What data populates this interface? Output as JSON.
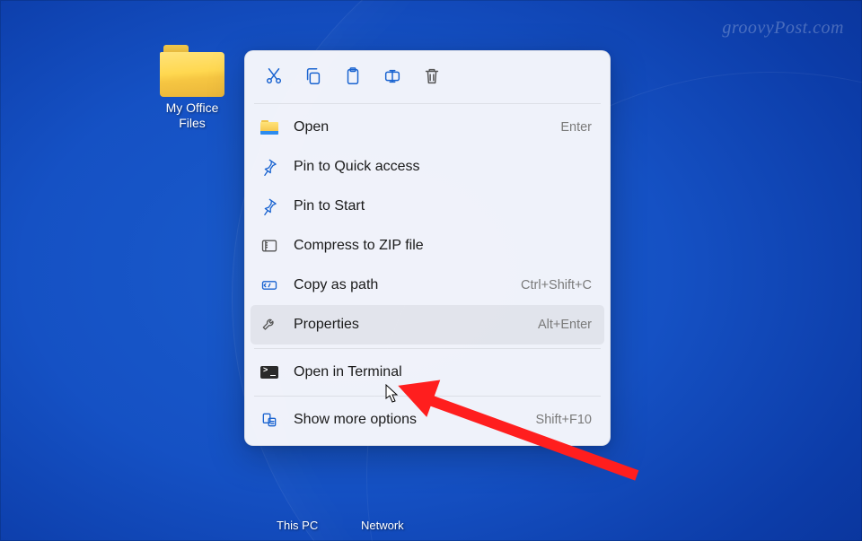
{
  "watermark": "groovyPost.com",
  "folder": {
    "label": "My Office\nFiles"
  },
  "toolbar": {
    "cut": "cut",
    "copy": "copy",
    "paste": "paste",
    "rename": "rename",
    "delete": "delete"
  },
  "menu": {
    "open": {
      "label": "Open",
      "shortcut": "Enter"
    },
    "pinquick": {
      "label": "Pin to Quick access",
      "shortcut": ""
    },
    "pinstart": {
      "label": "Pin to Start",
      "shortcut": ""
    },
    "zip": {
      "label": "Compress to ZIP file",
      "shortcut": ""
    },
    "copypath": {
      "label": "Copy as path",
      "shortcut": "Ctrl+Shift+C"
    },
    "properties": {
      "label": "Properties",
      "shortcut": "Alt+Enter"
    },
    "terminal": {
      "label": "Open in Terminal",
      "shortcut": ""
    },
    "more": {
      "label": "Show more options",
      "shortcut": "Shift+F10"
    }
  },
  "desktopLabels": {
    "thispc": "This PC",
    "network": "Network"
  }
}
